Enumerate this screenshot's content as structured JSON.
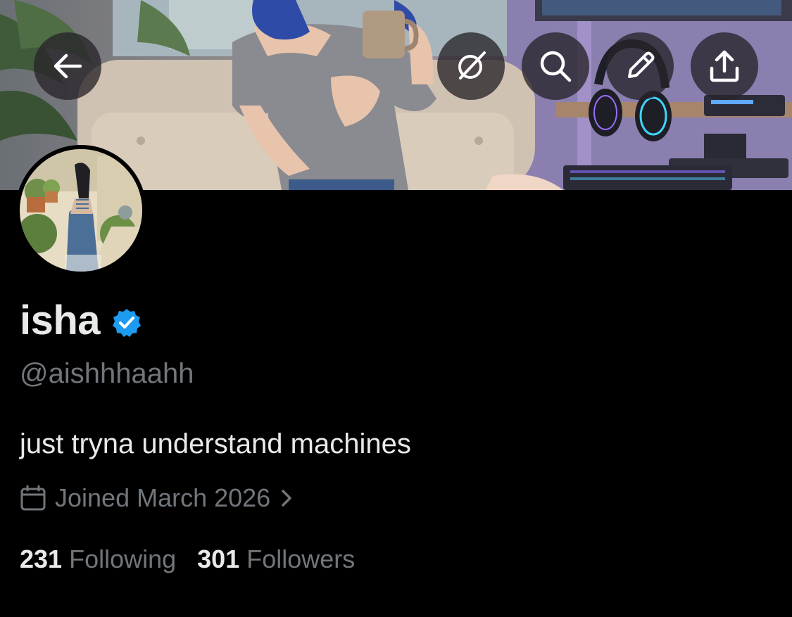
{
  "profile": {
    "display_name": "isha",
    "handle": "@aishhhaahh",
    "bio": "just tryna understand machines",
    "joined": "Joined March 2026",
    "following_count": "231",
    "following_label": "Following",
    "followers_count": "301",
    "followers_label": "Followers"
  },
  "header_actions": [
    {
      "name": "back",
      "icon": "arrow-left-icon"
    },
    {
      "name": "grok",
      "icon": "grok-icon"
    },
    {
      "name": "search",
      "icon": "search-icon"
    },
    {
      "name": "edit",
      "icon": "pencil-icon"
    },
    {
      "name": "share",
      "icon": "share-icon"
    }
  ],
  "colors": {
    "background": "#000000",
    "primary_text": "#e7e9ea",
    "secondary_text": "#71767b",
    "verified_blue": "#1d9bf0",
    "button_bg": "rgba(40,36,42,0.78)"
  }
}
